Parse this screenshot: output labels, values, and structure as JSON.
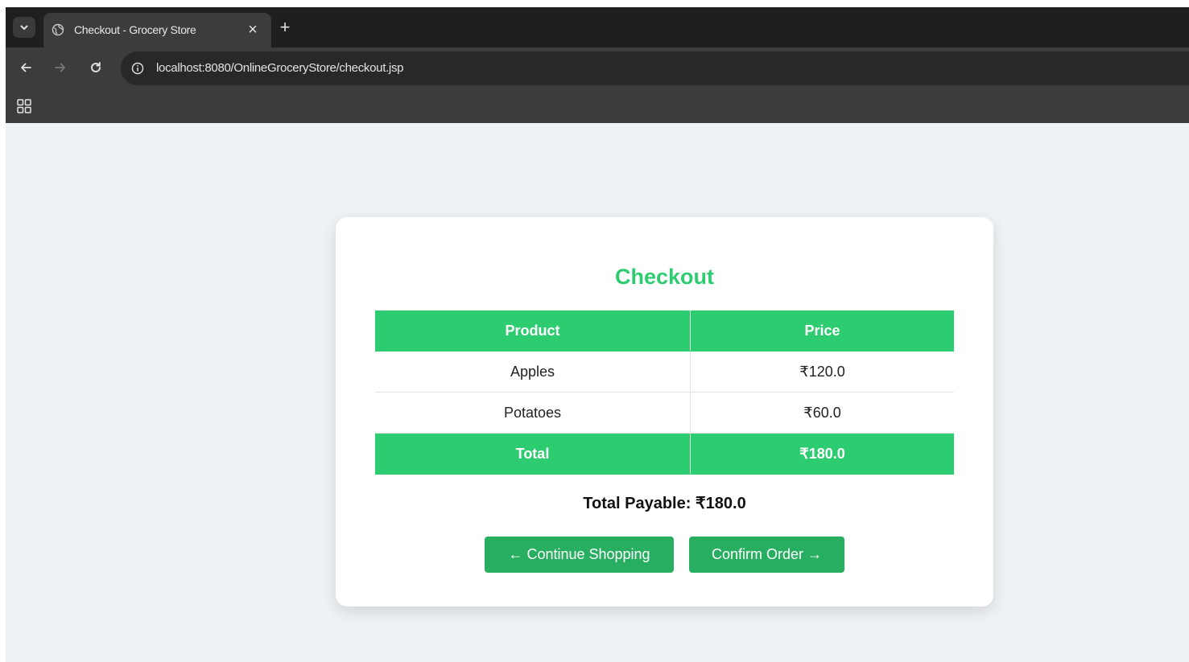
{
  "browser": {
    "tab": {
      "title": "Checkout - Grocery Store"
    },
    "new_tab_symbol": "+",
    "close_symbol": "×",
    "address_bar": {
      "url": "localhost:8080/OnlineGroceryStore/checkout.jsp"
    }
  },
  "checkout": {
    "title": "Checkout",
    "table": {
      "headers": [
        "Product",
        "Price"
      ],
      "rows": [
        {
          "product": "Apples",
          "price": "₹120.0"
        },
        {
          "product": "Potatoes",
          "price": "₹60.0"
        }
      ],
      "total": {
        "label": "Total",
        "value": "₹180.0"
      }
    },
    "total_payable": "Total Payable: ₹180.0",
    "buttons": {
      "continue_label": "← Continue Shopping",
      "confirm_label": "Confirm Order →"
    }
  },
  "colors": {
    "accent": "#2ecc71",
    "button": "#27ae60",
    "page_background": "#eef2f5"
  }
}
